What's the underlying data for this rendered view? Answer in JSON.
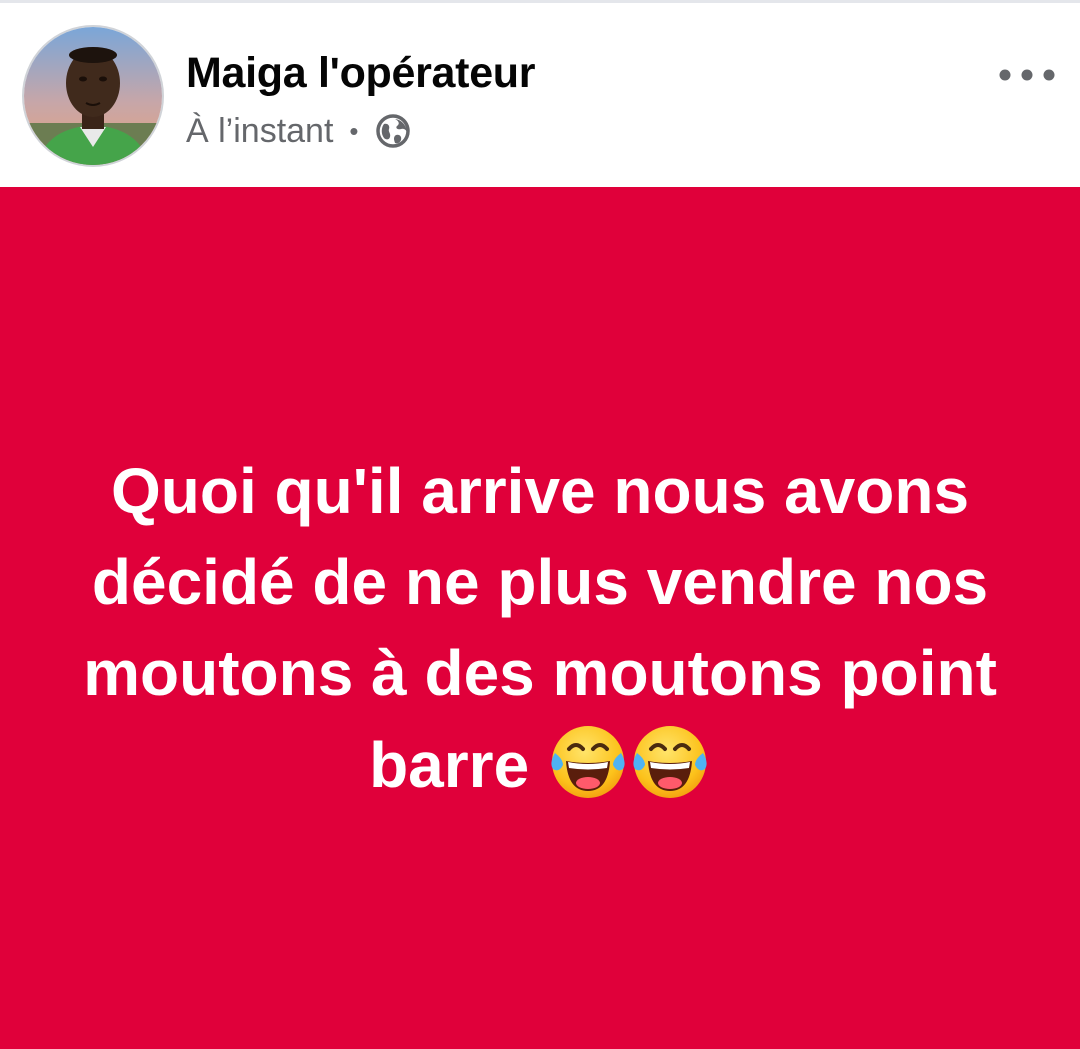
{
  "post": {
    "author_name": "Maiga l'opérateur",
    "timestamp": "À l’instant",
    "separator": "•",
    "audience_icon": "globe-icon",
    "more_icon": "more-options-icon",
    "text": "Quoi qu'il arrive nous avons décidé de ne plus vendre nos moutons à des moutons point barre",
    "emoji": [
      "face-with-tears-of-joy-icon",
      "face-with-tears-of-joy-icon"
    ],
    "background_color": "#e0003a",
    "text_color": "#ffffff"
  }
}
